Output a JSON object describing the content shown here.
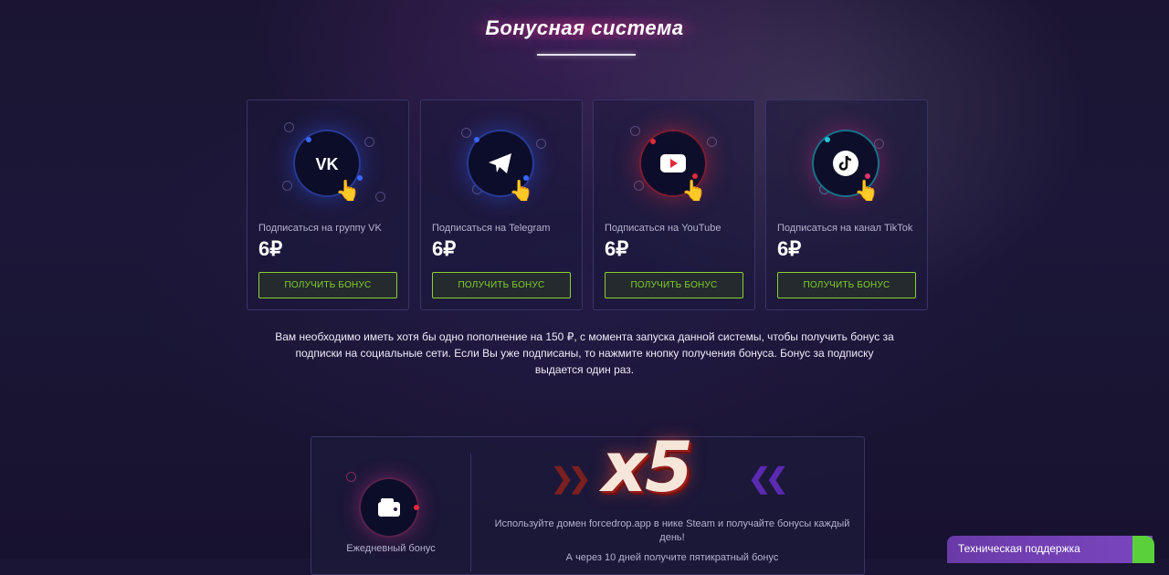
{
  "section": {
    "title": "Бонусная система"
  },
  "cards": [
    {
      "label": "Подписаться на группу VK",
      "amount": "6₽",
      "button": "ПОЛУЧИТЬ БОНУС",
      "icon": "vk-icon",
      "accent": "#2f5cff"
    },
    {
      "label": "Подписаться на Telegram",
      "amount": "6₽",
      "button": "ПОЛУЧИТЬ БОНУС",
      "icon": "telegram-icon",
      "accent": "#2f5cff"
    },
    {
      "label": "Подписаться на YouTube",
      "amount": "6₽",
      "button": "ПОЛУЧИТЬ БОНУС",
      "icon": "youtube-icon",
      "accent": "#e02a3a"
    },
    {
      "label": "Подписаться на канал TikTok",
      "amount": "6₽",
      "button": "ПОЛУЧИТЬ БОНУС",
      "icon": "tiktok-icon",
      "accent": "#23c6d6"
    }
  ],
  "info_text": "Вам необходимо иметь хотя бы одно пополнение на 150 ₽, с момента запуска данной системы, чтобы получить бонус за подписки на социальные сети. Если Вы уже подписаны, то нажмите кнопку получения бонуса. Бонус за подписку выдается один раз.",
  "daily": {
    "label": "Ежедневный бонус",
    "icon": "wallet-icon"
  },
  "promo": {
    "multiplier": "x5",
    "text": "Используйте домен forcedrop.app в нике Steam и получайте бонусы каждый день!",
    "text2": "А через 10 дней получите пятикратный бонус"
  },
  "support": {
    "label": "Техническая поддержка"
  },
  "colors": {
    "button_border": "#8bd12e",
    "button_text": "#7fd02a",
    "support_bg": "#6a3aa8",
    "support_accent": "#5ad13b"
  }
}
